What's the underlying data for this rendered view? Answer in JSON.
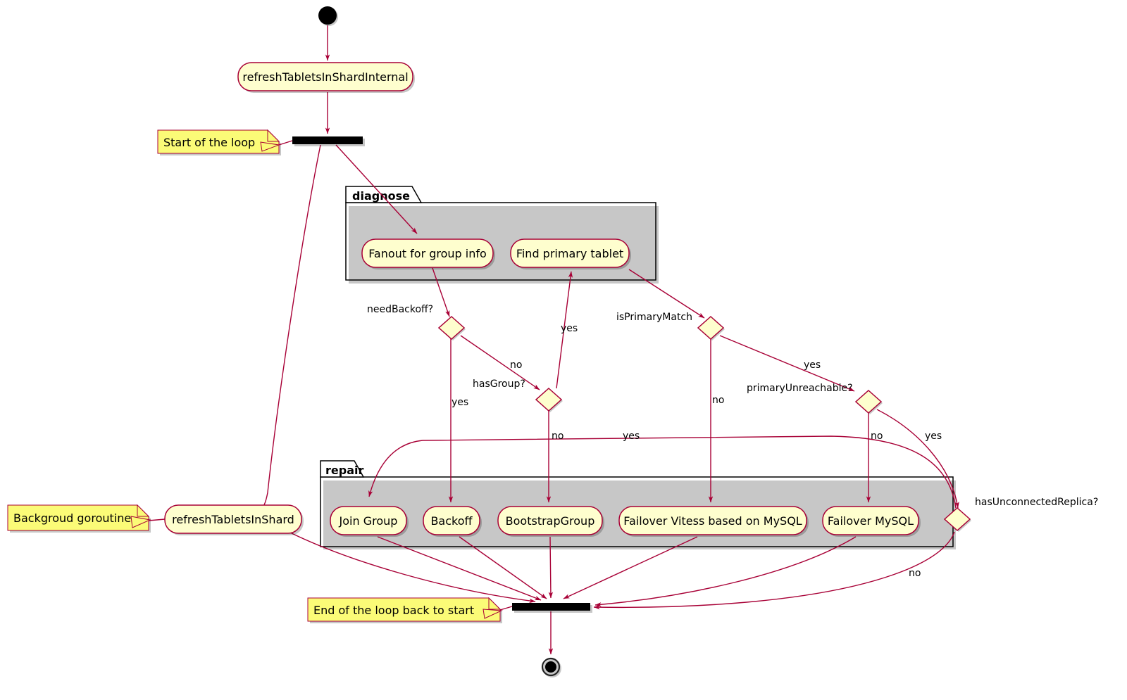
{
  "diagram": {
    "type": "uml-activity-diagram",
    "title": "Vitess shard refresh / repair loop",
    "colors": {
      "node_fill": "#FEFECE",
      "node_stroke": "#A80036",
      "note_fill": "#FBFB77",
      "note_stroke": "#A80036",
      "package_stroke": "#000000",
      "edge_stroke": "#A80036",
      "bar_fill": "#000000",
      "background": "#FFFFFF"
    }
  },
  "nodes": {
    "start": {
      "kind": "initial-node"
    },
    "end": {
      "kind": "final-node"
    },
    "fork_top": {
      "kind": "fork-bar"
    },
    "join_bottom": {
      "kind": "join-bar"
    },
    "activities": [
      {
        "id": "refreshTabletsInShardInternal",
        "label": "refreshTabletsInShardInternal"
      },
      {
        "id": "fanoutForGroupInfo",
        "label": "Fanout for group info"
      },
      {
        "id": "findPrimaryTablet",
        "label": "Find primary tablet"
      },
      {
        "id": "refreshTabletsInShard",
        "label": "refreshTabletsInShard"
      },
      {
        "id": "joinGroup",
        "label": "Join Group"
      },
      {
        "id": "backoff",
        "label": "Backoff"
      },
      {
        "id": "bootstrapGroup",
        "label": "BootstrapGroup"
      },
      {
        "id": "failoverVitess",
        "label": "Failover Vitess based on MySQL"
      },
      {
        "id": "failoverMysql",
        "label": "Failover MySQL"
      }
    ],
    "decisions": [
      {
        "id": "needBackoff",
        "label": "needBackoff?"
      },
      {
        "id": "hasGroup",
        "label": "hasGroup?"
      },
      {
        "id": "isPrimaryMatch",
        "label": "isPrimaryMatch"
      },
      {
        "id": "primaryUnreachable",
        "label": "primaryUnreachable?"
      },
      {
        "id": "hasUnconnectedReplica",
        "label": "hasUnconnectedReplica?"
      }
    ]
  },
  "packages": [
    {
      "id": "diagnose",
      "label": "diagnose",
      "members": [
        "fanoutForGroupInfo",
        "findPrimaryTablet"
      ]
    },
    {
      "id": "repair",
      "label": "repair",
      "members": [
        "joinGroup",
        "backoff",
        "bootstrapGroup",
        "failoverVitess",
        "failoverMysql"
      ]
    }
  ],
  "notes": [
    {
      "id": "note-start-loop",
      "text": "Start of the loop",
      "anchor": "fork_top"
    },
    {
      "id": "note-background-goroutine",
      "text": "Backgroud goroutine",
      "anchor": "refreshTabletsInShard"
    },
    {
      "id": "note-end-loop",
      "text": "End of the loop back to start",
      "anchor": "join_bottom"
    }
  ],
  "edge_labels": {
    "needBackoff_yes": "yes",
    "needBackoff_no": "no",
    "hasGroup_yes": "yes",
    "hasGroup_no": "no",
    "isPrimaryMatch_yes": "yes",
    "isPrimaryMatch_no": "no",
    "primaryUnreachable_yes": "yes",
    "primaryUnreachable_no": "no",
    "hasUnconnectedReplica_yes": "yes",
    "hasUnconnectedReplica_no": "no"
  },
  "edges": [
    {
      "from": "start",
      "to": "refreshTabletsInShardInternal",
      "label": ""
    },
    {
      "from": "refreshTabletsInShardInternal",
      "to": "fork_top",
      "label": ""
    },
    {
      "from": "fork_top",
      "to": "refreshTabletsInShard",
      "label": ""
    },
    {
      "from": "fork_top",
      "to": "fanoutForGroupInfo",
      "label": ""
    },
    {
      "from": "fanoutForGroupInfo",
      "to": "needBackoff",
      "label": ""
    },
    {
      "from": "needBackoff",
      "to": "backoff",
      "label": "yes"
    },
    {
      "from": "needBackoff",
      "to": "hasGroup",
      "label": "no"
    },
    {
      "from": "hasGroup",
      "to": "bootstrapGroup",
      "label": "no"
    },
    {
      "from": "hasGroup",
      "to": "findPrimaryTablet",
      "label": "yes"
    },
    {
      "from": "findPrimaryTablet",
      "to": "isPrimaryMatch",
      "label": ""
    },
    {
      "from": "isPrimaryMatch",
      "to": "failoverVitess",
      "label": "no"
    },
    {
      "from": "isPrimaryMatch",
      "to": "primaryUnreachable",
      "label": "yes"
    },
    {
      "from": "primaryUnreachable",
      "to": "failoverMysql",
      "label": "no"
    },
    {
      "from": "primaryUnreachable",
      "to": "hasUnconnectedReplica",
      "label": "yes"
    },
    {
      "from": "hasUnconnectedReplica",
      "to": "joinGroup",
      "label": "yes"
    },
    {
      "from": "hasUnconnectedReplica",
      "to": "join_bottom",
      "label": "no"
    },
    {
      "from": "refreshTabletsInShard",
      "to": "join_bottom",
      "label": ""
    },
    {
      "from": "joinGroup",
      "to": "join_bottom",
      "label": ""
    },
    {
      "from": "backoff",
      "to": "join_bottom",
      "label": ""
    },
    {
      "from": "bootstrapGroup",
      "to": "join_bottom",
      "label": ""
    },
    {
      "from": "failoverVitess",
      "to": "join_bottom",
      "label": ""
    },
    {
      "from": "failoverMysql",
      "to": "join_bottom",
      "label": ""
    },
    {
      "from": "join_bottom",
      "to": "end",
      "label": ""
    }
  ]
}
